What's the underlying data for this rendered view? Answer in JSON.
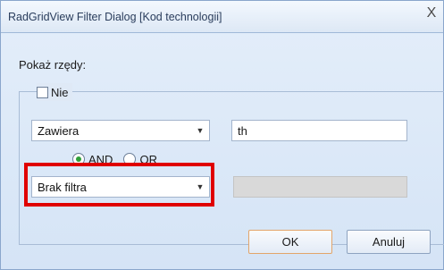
{
  "window": {
    "title": "RadGridView Filter Dialog [Kod technologii]",
    "close_glyph": "X"
  },
  "show_rows_label": "Pokaż rzędy:",
  "not_checkbox": {
    "label": "Nie",
    "checked": false
  },
  "filter1": {
    "operator": "Zawiera",
    "value": "th"
  },
  "logic": {
    "and_label": "AND",
    "or_label": "OR",
    "selected": "AND"
  },
  "filter2": {
    "operator": "Brak filtra",
    "value": ""
  },
  "buttons": {
    "ok": "OK",
    "cancel": "Anuluj"
  },
  "icons": {
    "dropdown": "chevron-down-icon",
    "close": "close-icon"
  },
  "colors": {
    "highlight": "#e00000",
    "radio_selected": "#2fa03a",
    "default_button_border": "#e3a56a"
  }
}
